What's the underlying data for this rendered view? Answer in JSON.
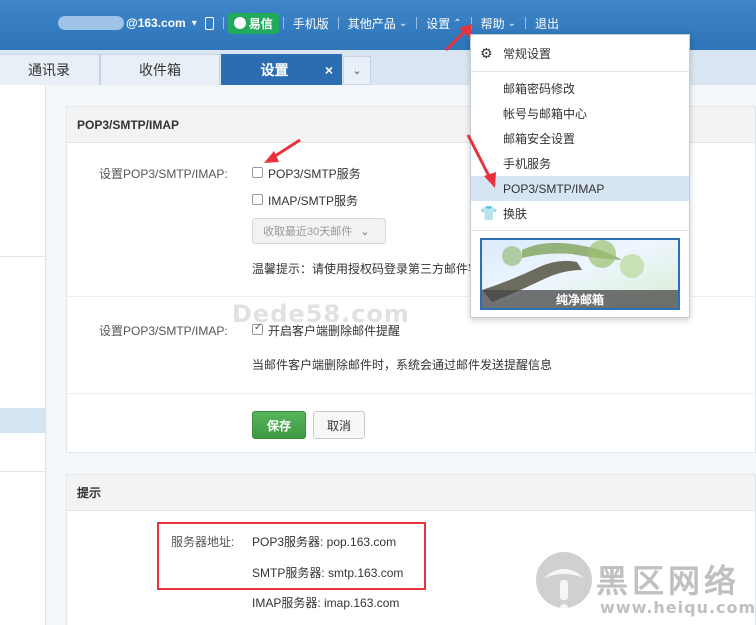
{
  "topbar": {
    "account": "@163.com",
    "yixin": "易信",
    "nav": [
      "手机版",
      "其他产品",
      "设置",
      "帮助",
      "退出"
    ]
  },
  "tabs": {
    "contacts": "通讯录",
    "inbox": "收件箱",
    "settings": "设置",
    "close": "×"
  },
  "section1": {
    "title": "POP3/SMTP/IMAP",
    "label1": "设置POP3/SMTP/IMAP:",
    "opt_pop3": "POP3/SMTP服务",
    "opt_imap": "IMAP/SMTP服务",
    "select_value": "收取最近30天邮件",
    "tip": "温馨提示：请使用授权码登录第三方邮件客",
    "label2": "设置POP3/SMTP/IMAP:",
    "opt_notify": "开启客户端删除邮件提醒",
    "notify_desc": "当邮件客户端删除邮件时，系统会通过邮件发送提醒信息",
    "save": "保存",
    "cancel": "取消"
  },
  "section2": {
    "title": "提示",
    "server_label": "服务器地址:",
    "pop3": "POP3服务器: pop.163.com",
    "smtp": "SMTP服务器: smtp.163.com",
    "imap": "IMAP服务器: imap.163.com"
  },
  "dropdown": {
    "general": "常规设置",
    "items": [
      "邮箱密码修改",
      "帐号与邮箱中心",
      "邮箱安全设置",
      "手机服务",
      "POP3/SMTP/IMAP"
    ],
    "skin": "换肤",
    "skin_caption": "纯净邮箱"
  },
  "watermarks": {
    "dede": "Dede58.com",
    "brand": "黑区网络",
    "url": "www.heiqu.com"
  },
  "colors": {
    "topbar": "#3179be",
    "active_tab": "#2b6db0",
    "save_button": "#4aa84e",
    "highlight_box": "#e8323c",
    "arrow": "#e8323c"
  }
}
